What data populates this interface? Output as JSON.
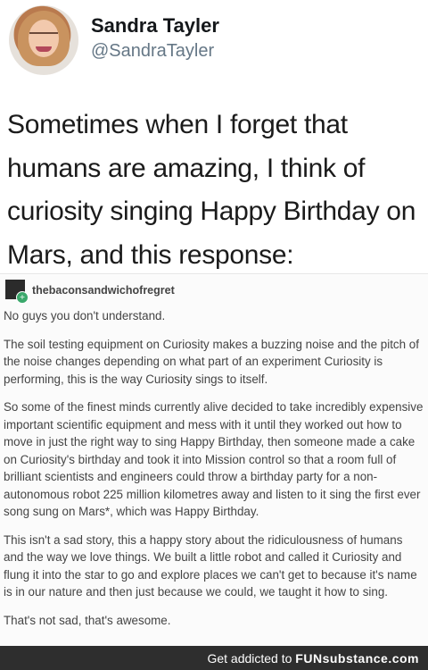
{
  "tweet": {
    "display_name": "Sandra Tayler",
    "handle": "@SandraTayler",
    "text": "Sometimes when I forget that humans are amazing, I think of curiosity singing Happy Birthday on Mars, and this response:"
  },
  "tumblr": {
    "username": "thebaconsandwichofregret",
    "badge_icon": "plus-icon",
    "paragraphs": [
      "No guys you don't understand.",
      "The soil testing equipment on Curiosity makes a buzzing noise and the pitch of the noise changes depending on what part of an experiment Curiosity is performing, this is the way Curiosity sings to itself.",
      "So some of the finest minds currently alive decided to take incredibly expensive important scientific equipment and mess with it until they worked out how to move in just the right way to sing Happy Birthday, then someone made a cake on Curiosity's birthday and took it into Mission control so that a room full of brilliant scientists and engineers could throw a birthday party for a non-autonomous robot 225 million kilometres away and listen to it sing the first ever song sung on Mars*, which was Happy Birthday.",
      "This isn't a sad story, this a happy story about the ridiculousness of humans and the way we love things. We built a little robot and called it Curiosity and flung it into the star to go and explore places we can't get to because it's name is in our nature and then just because we could, we taught it how to sing.",
      "That's not sad, that's awesome."
    ]
  },
  "footer": {
    "prefix": "Get addicted to",
    "brand": "FUNsubstance.com"
  }
}
